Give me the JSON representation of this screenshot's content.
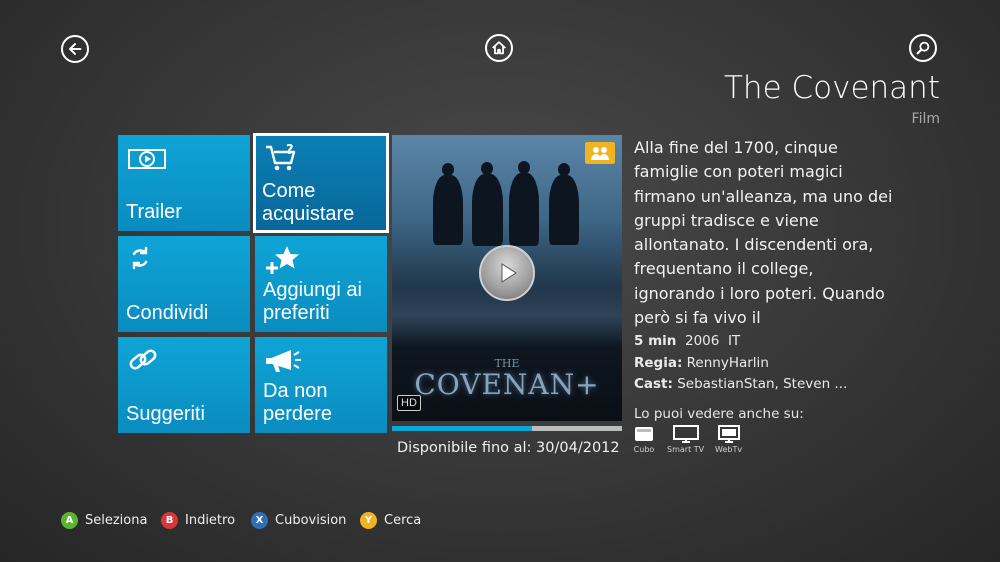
{
  "nav": {
    "back_icon": "back-arrow-icon",
    "home_icon": "home-icon",
    "search_icon": "search-icon"
  },
  "header": {
    "title": "The Covenant",
    "subtitle": "Film"
  },
  "tiles": [
    {
      "label": "Trailer",
      "icon": "trailer-icon"
    },
    {
      "label": "Come acquistare",
      "icon": "cart-icon",
      "selected": true
    },
    {
      "label": "Condividi",
      "icon": "share-arrows-icon"
    },
    {
      "label": "Aggiungi ai preferiti",
      "icon": "star-plus-icon"
    },
    {
      "label": "Suggeriti",
      "icon": "link-icon"
    },
    {
      "label": "Da non perdere",
      "icon": "megaphone-icon"
    }
  ],
  "poster": {
    "logo_small": "THE",
    "logo": "COVENAN+",
    "hd_badge": "HD",
    "family_badge_icon": "family-icon",
    "play_icon": "play-icon"
  },
  "progress": {
    "fraction": 0.61
  },
  "availability": "Disponibile fino al: 30/04/2012",
  "details": {
    "description": "Alla fine del 1700, cinque famiglie con poteri magici firmano un'alleanza, ma uno dei gruppi tradisce e viene allontanato. I discendenti ora, frequentano il college, ignorando i loro poteri. Quando però si fa vivo il",
    "duration": "5 min",
    "year": "2006",
    "country": "IT",
    "director_label": "Regia:",
    "director": "RennyHarlin",
    "cast_label": "Cast:",
    "cast": "SebastianStan, Steven ..."
  },
  "also_available": {
    "label": "Lo puoi vedere anche su:",
    "devices": [
      {
        "name": "Cubo",
        "icon": "cubo-icon"
      },
      {
        "name": "Smart TV",
        "icon": "tv-icon"
      },
      {
        "name": "WebTv",
        "icon": "monitor-icon"
      }
    ]
  },
  "footer": [
    {
      "key": "A",
      "label": "Seleziona",
      "color": "#5cb531"
    },
    {
      "key": "B",
      "label": "Indietro",
      "color": "#d9363a"
    },
    {
      "key": "X",
      "label": "Cubovision",
      "color": "#2e6fba"
    },
    {
      "key": "Y",
      "label": "Cerca",
      "color": "#f0b322"
    }
  ]
}
